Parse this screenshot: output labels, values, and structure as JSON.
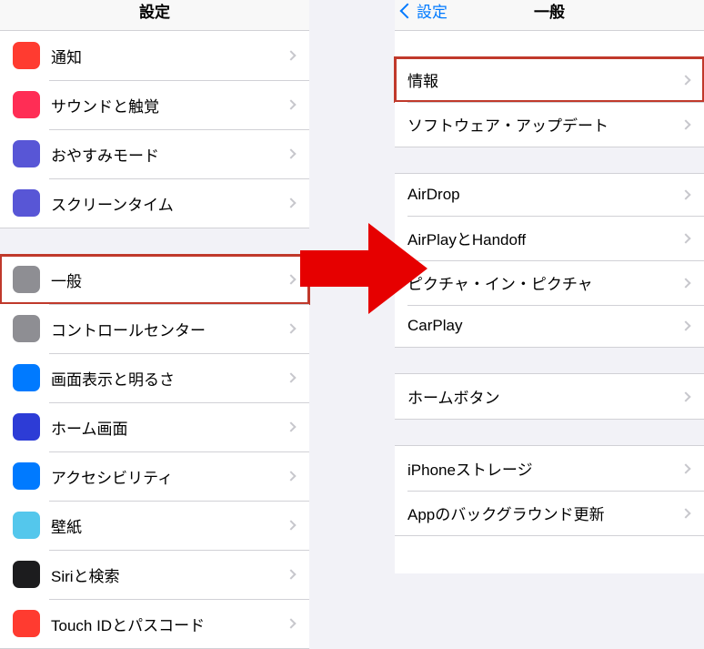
{
  "left": {
    "title": "設定",
    "group1": [
      {
        "label": "通知",
        "iconColor": "#ff3b30",
        "iconName": "notifications-icon"
      },
      {
        "label": "サウンドと触覚",
        "iconColor": "#ff2d55",
        "iconName": "sounds-icon"
      },
      {
        "label": "おやすみモード",
        "iconColor": "#5856d6",
        "iconName": "do-not-disturb-icon"
      },
      {
        "label": "スクリーンタイム",
        "iconColor": "#5856d6",
        "iconName": "screen-time-icon"
      }
    ],
    "group2": [
      {
        "label": "一般",
        "iconColor": "#8e8e93",
        "iconName": "general-icon",
        "highlighted": true
      },
      {
        "label": "コントロールセンター",
        "iconColor": "#8e8e93",
        "iconName": "control-center-icon"
      },
      {
        "label": "画面表示と明るさ",
        "iconColor": "#007aff",
        "iconName": "display-icon"
      },
      {
        "label": "ホーム画面",
        "iconColor": "#2d3cd6",
        "iconName": "home-screen-icon"
      },
      {
        "label": "アクセシビリティ",
        "iconColor": "#007aff",
        "iconName": "accessibility-icon"
      },
      {
        "label": "壁紙",
        "iconColor": "#54c7ec",
        "iconName": "wallpaper-icon"
      },
      {
        "label": "Siriと検索",
        "iconColor": "#1c1c1e",
        "iconName": "siri-icon"
      },
      {
        "label": "Touch IDとパスコード",
        "iconColor": "#ff3b30",
        "iconName": "touch-id-icon"
      }
    ]
  },
  "right": {
    "back": "設定",
    "title": "一般",
    "group1": [
      {
        "label": "情報",
        "highlighted": true
      },
      {
        "label": "ソフトウェア・アップデート"
      }
    ],
    "group2": [
      {
        "label": "AirDrop"
      },
      {
        "label": "AirPlayとHandoff"
      },
      {
        "label": "ピクチャ・イン・ピクチャ"
      },
      {
        "label": "CarPlay"
      }
    ],
    "group3": [
      {
        "label": "ホームボタン"
      }
    ],
    "group4": [
      {
        "label": "iPhoneストレージ"
      },
      {
        "label": "Appのバックグラウンド更新"
      }
    ]
  }
}
